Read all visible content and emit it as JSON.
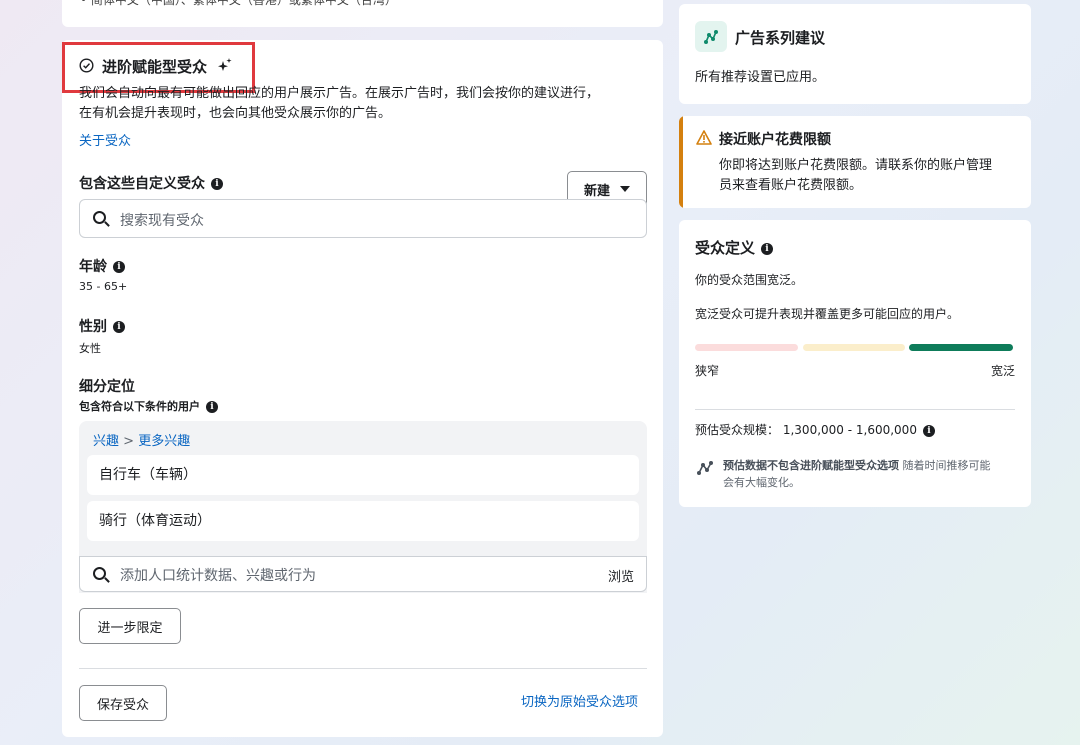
{
  "top_card": {
    "strip_text": "• 简体中文（中国）、繁体中文（香港）或繁体中文（台湾）"
  },
  "audience_card": {
    "title": "进阶赋能型受众",
    "description_line1": "我们会自动向最有可能做出回应的用户展示广告。在展示广告时，我们会按你的建议进行，",
    "description_line2": "在有机会提升表现时，也会向其他受众展示你的广告。",
    "about_link": "关于受众",
    "custom_audience_label": "包含这些自定义受众",
    "new_button": "新建",
    "search_placeholder": "搜索现有受众",
    "age_label": "年龄",
    "age_value": "35 - 65+",
    "gender_label": "性别",
    "gender_value": "女性",
    "targeting_label": "细分定位",
    "targeting_sub": "包含符合以下条件的用户",
    "breadcrumb_1": "兴趣",
    "breadcrumb_sep": ">",
    "breadcrumb_2": "更多兴趣",
    "interests": [
      "自行车（车辆）",
      "骑行（体育运动）"
    ],
    "add_placeholder": "添加人口统计数据、兴趣或行为",
    "browse": "浏览",
    "narrow_button": "进一步限定",
    "save_button": "保存受众",
    "switch_link": "切换为原始受众选项"
  },
  "campaign_suggestion": {
    "title": "广告系列建议",
    "body": "所有推荐设置已应用。",
    "accent": "#0e8a6b"
  },
  "spend_limit": {
    "title": "接近账户花费限额",
    "body_line1": "你即将达到账户花费限额。请联系你的账户管理",
    "body_line2": "员来查看账户花费限额。",
    "accent": "#d4800f"
  },
  "audience_definition": {
    "title": "受众定义",
    "status": "你的受众范围宽泛。",
    "explanation": "宽泛受众可提升表现并覆盖更多可能回应的用户。",
    "narrow_label": "狭窄",
    "broad_label": "宽泛",
    "scale_level": "broad",
    "segment_colors": [
      "#fbdcdc",
      "#fbeecb",
      "#0e7c5a"
    ],
    "size_label": "预估受众规模：",
    "size_value": "1,300,000 - 1,600,000",
    "note_bold": "预估数据不包含进阶赋能型受众选项",
    "note_line1_rest": "随着时间推移可能",
    "note_line2": "会有大幅变化。"
  }
}
